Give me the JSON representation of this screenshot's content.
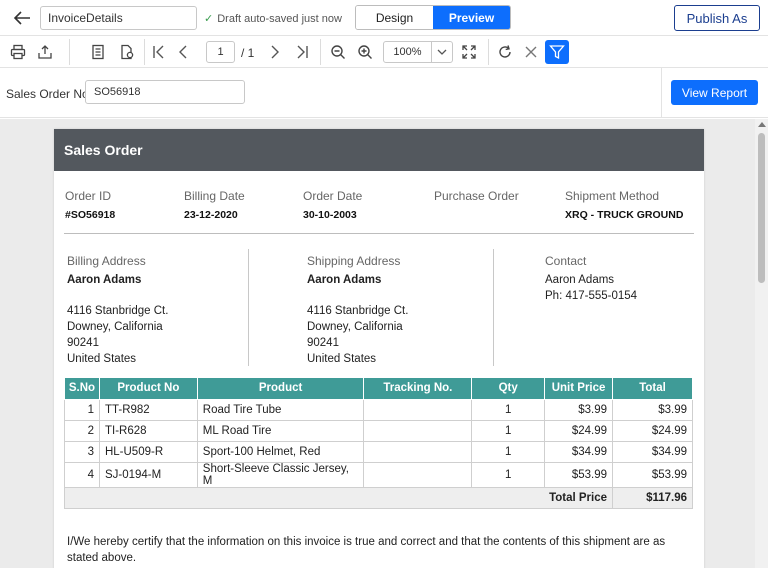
{
  "topbar": {
    "report_name": "InvoiceDetails",
    "saved_status": "Draft auto-saved just now",
    "tab_design": "Design",
    "tab_preview": "Preview",
    "publish_label": "Publish As"
  },
  "toolbar": {
    "page_current": "1",
    "page_total": "/ 1",
    "zoom": "100%"
  },
  "parameters": {
    "label": "Sales Order No:",
    "value": "SO56918",
    "view_report": "View Report"
  },
  "report": {
    "title": "Sales Order",
    "meta": [
      {
        "label": "Order ID",
        "value": "#SO56918"
      },
      {
        "label": "Billing Date",
        "value": "23-12-2020"
      },
      {
        "label": "Order Date",
        "value": "30-10-2003"
      },
      {
        "label": "Purchase Order",
        "value": ""
      },
      {
        "label": "Shipment Method",
        "value": "XRQ - TRUCK GROUND"
      }
    ],
    "billing": {
      "label": "Billing Address",
      "name": "Aaron Adams",
      "line1": "4116 Stanbridge Ct.",
      "line2": "Downey, California",
      "line3": "90241",
      "line4": "United States"
    },
    "shipping": {
      "label": "Shipping Address",
      "name": "Aaron Adams",
      "line1": "4116 Stanbridge Ct.",
      "line2": "Downey, California",
      "line3": "90241",
      "line4": "United States"
    },
    "contact": {
      "label": "Contact",
      "name": "Aaron Adams",
      "phone": "Ph: 417-555-0154"
    },
    "table": {
      "headers": [
        "S.No",
        "Product No",
        "Product",
        "Tracking No.",
        "Qty",
        "Unit Price",
        "Total"
      ],
      "rows": [
        [
          "1",
          "TT-R982",
          "Road Tire Tube",
          "",
          "1",
          "$3.99",
          "$3.99"
        ],
        [
          "2",
          "TI-R628",
          "ML Road Tire",
          "",
          "1",
          "$24.99",
          "$24.99"
        ],
        [
          "3",
          "HL-U509-R",
          "Sport-100 Helmet, Red",
          "",
          "1",
          "$34.99",
          "$34.99"
        ],
        [
          "4",
          "SJ-0194-M",
          "Short-Sleeve Classic Jersey, M",
          "",
          "1",
          "$53.99",
          "$53.99"
        ]
      ],
      "total_label": "Total Price",
      "total_value": "$117.96"
    },
    "certify": "I/We hereby certify that the information on this invoice is true and correct and that the contents of this shipment are as stated above."
  }
}
